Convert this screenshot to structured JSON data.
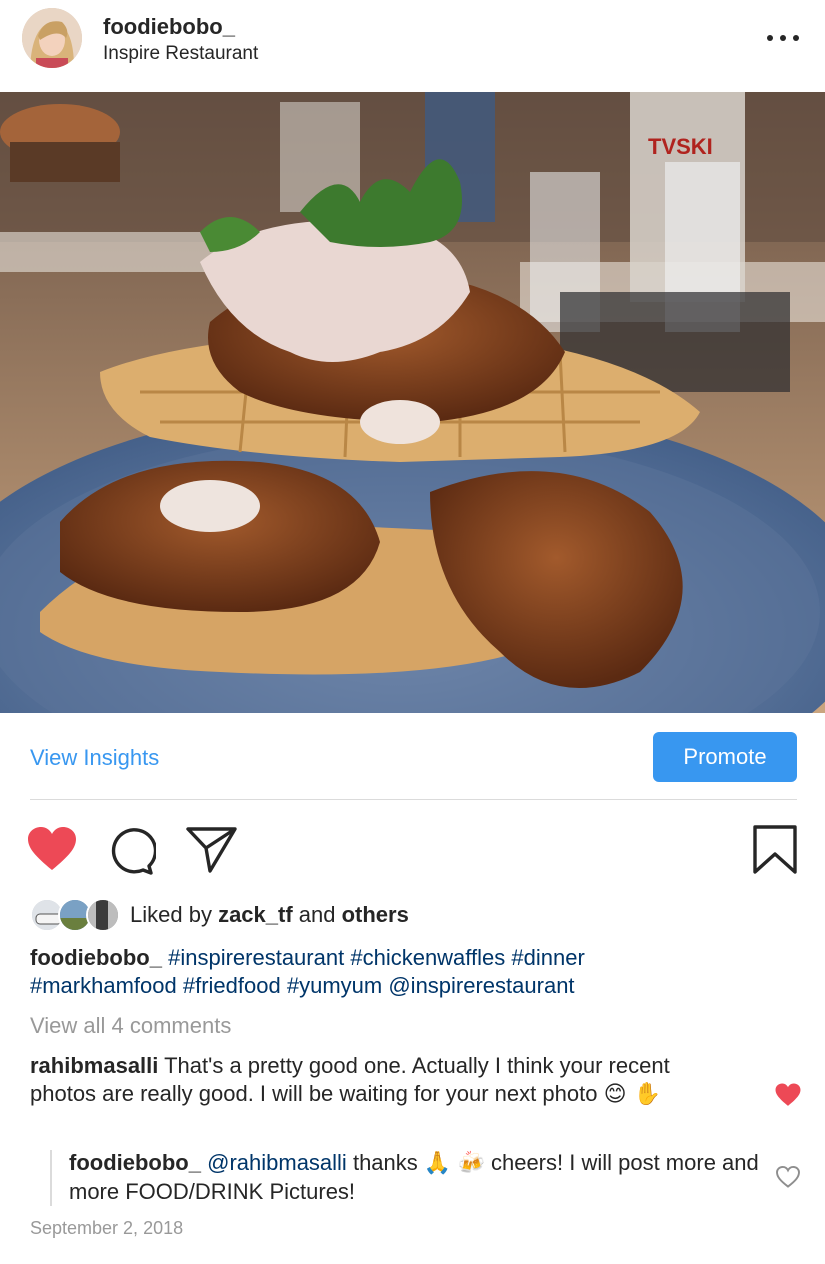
{
  "post": {
    "username": "foodiebobo_",
    "location": "Inspire Restaurant",
    "photo_sign_text": "TVSKI"
  },
  "insights": {
    "view_insights_label": "View Insights",
    "promote_label": "Promote"
  },
  "likes": {
    "prefix": "Liked by ",
    "user": "zack_tf",
    "middle": " and ",
    "others": "others"
  },
  "caption": {
    "username": "foodiebobo_",
    "tags": [
      "#inspirerestaurant",
      "#chickenwaffles",
      "#dinner",
      "#markhamfood",
      "#friedfood",
      "#yumyum",
      "@inspirerestaurant"
    ]
  },
  "comments": {
    "view_all_label": "View all 4 comments",
    "items": [
      {
        "username": "rahibmasalli",
        "text": "That's a pretty good one. Actually I think your recent photos are really good. I will be waiting for your next photo",
        "emojis": "😊 ✋",
        "liked": true
      },
      {
        "username": "foodiebobo_",
        "mention": "@rahibmasalli",
        "text_before": "thanks",
        "emoji1": "🙏",
        "emoji2": "🍻",
        "text_after": "cheers! I will post more and more FOOD/DRINK Pictures!",
        "liked": false
      }
    ]
  },
  "date": "September 2, 2018",
  "colors": {
    "accent_blue": "#3897f0",
    "heart_red": "#ed4956",
    "hashtag": "#003569",
    "muted_text": "#999999"
  },
  "icons": [
    "more-icon",
    "heart-icon",
    "comment-icon",
    "share-icon",
    "bookmark-icon"
  ]
}
